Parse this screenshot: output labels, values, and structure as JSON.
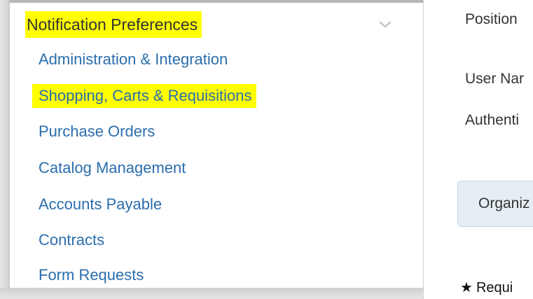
{
  "sidebar": {
    "section_title": "Notification Preferences",
    "toggle_icon": "chevron-down-icon",
    "items": [
      {
        "label": "Administration & Integration",
        "highlighted": false
      },
      {
        "label": "Shopping, Carts & Requisitions",
        "highlighted": true
      },
      {
        "label": "Purchase Orders",
        "highlighted": false
      },
      {
        "label": "Catalog Management",
        "highlighted": false
      },
      {
        "label": "Accounts Payable",
        "highlighted": false
      },
      {
        "label": "Contracts",
        "highlighted": false
      },
      {
        "label": "Form Requests",
        "highlighted": false
      }
    ]
  },
  "main": {
    "fields": [
      {
        "label": "Position"
      },
      {
        "label": "User Nar"
      },
      {
        "label": "Authenti"
      }
    ],
    "org_box_label": "Organiz",
    "required_icon": "star-icon",
    "required_label": "Requi"
  },
  "colors": {
    "highlight": "#ffff00",
    "link": "#2a6ead",
    "org_box_bg": "#e5eef5"
  }
}
